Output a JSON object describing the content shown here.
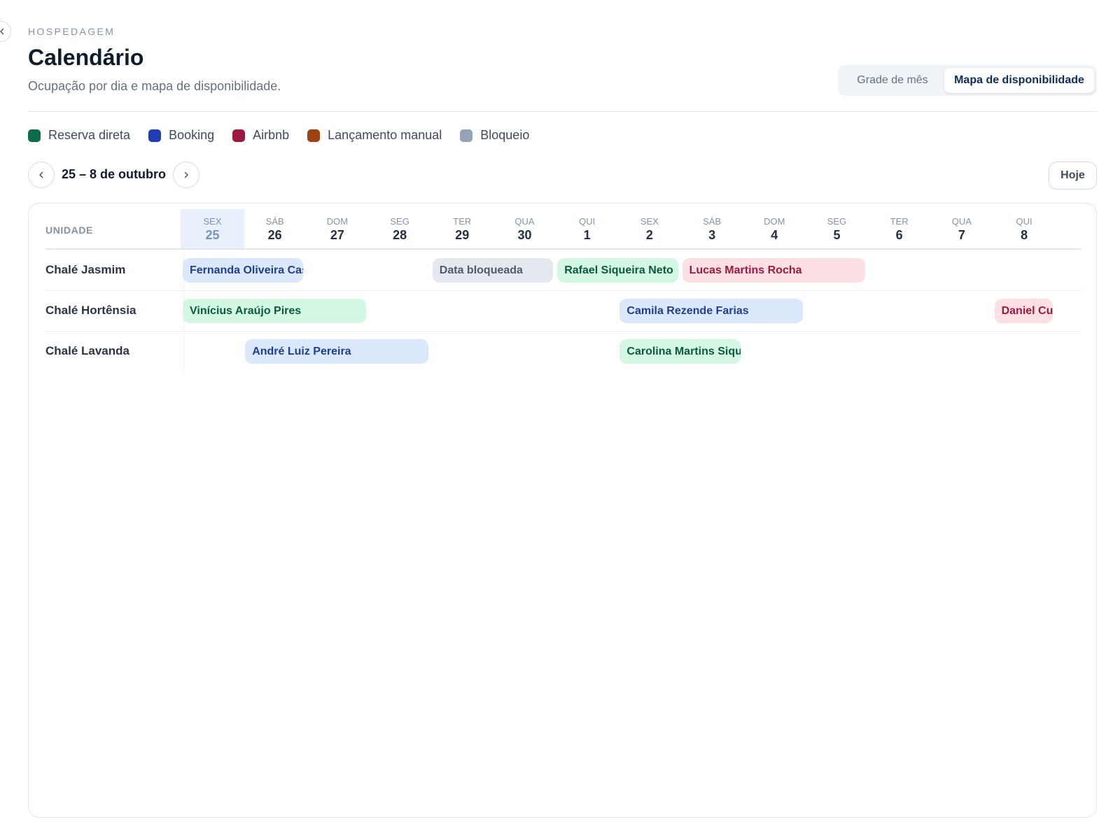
{
  "header": {
    "eyebrow": "HOSPEDAGEM",
    "title": "Calendário",
    "subtitle": "Ocupação por dia e mapa de disponibilidade."
  },
  "view_toggle": {
    "month_grid": "Grade de mês",
    "availability_map": "Mapa de disponibilidade",
    "selected": "availability_map"
  },
  "legend": [
    {
      "label": "Reserva direta",
      "color": "#0b6b4a"
    },
    {
      "label": "Booking",
      "color": "#1f3fb0"
    },
    {
      "label": "Airbnb",
      "color": "#a0183f"
    },
    {
      "label": "Lançamento manual",
      "color": "#9a4210"
    },
    {
      "label": "Bloqueio",
      "color": "#94a3b8"
    }
  ],
  "navigation": {
    "range_label": "25 – 8 de outubro",
    "today_label": "Hoje"
  },
  "grid": {
    "unit_header": "UNIDADE",
    "today_index": 0,
    "days": [
      {
        "dow": "SEX",
        "num": "25"
      },
      {
        "dow": "SÁB",
        "num": "26"
      },
      {
        "dow": "DOM",
        "num": "27"
      },
      {
        "dow": "SEG",
        "num": "28"
      },
      {
        "dow": "TER",
        "num": "29"
      },
      {
        "dow": "QUA",
        "num": "30"
      },
      {
        "dow": "QUI",
        "num": "1"
      },
      {
        "dow": "SEX",
        "num": "2"
      },
      {
        "dow": "SÁB",
        "num": "3"
      },
      {
        "dow": "DOM",
        "num": "4"
      },
      {
        "dow": "SEG",
        "num": "5"
      },
      {
        "dow": "TER",
        "num": "6"
      },
      {
        "dow": "QUA",
        "num": "7"
      },
      {
        "dow": "QUI",
        "num": "8"
      }
    ],
    "units": [
      {
        "name": "Chalé Jasmim",
        "bookings": [
          {
            "label": "Fernanda Oliveira Cast",
            "source": "booking",
            "start": 0,
            "end": 2
          },
          {
            "label": "Data bloqueada",
            "source": "block",
            "start": 4,
            "end": 6
          },
          {
            "label": "Rafael Siqueira Neto",
            "source": "direct",
            "start": 6,
            "end": 8
          },
          {
            "label": "Lucas Martins Rocha",
            "source": "airbnb",
            "start": 8,
            "end": 11
          }
        ]
      },
      {
        "name": "Chalé Hortênsia",
        "bookings": [
          {
            "label": "Vinícius Araújo Pires",
            "source": "direct",
            "start": 0,
            "end": 3
          },
          {
            "label": "Camila Rezende Farias",
            "source": "booking",
            "start": 7,
            "end": 10
          },
          {
            "label": "Daniel Cur",
            "source": "airbnb",
            "start": 13,
            "end": 14
          }
        ]
      },
      {
        "name": "Chalé Lavanda",
        "bookings": [
          {
            "label": "André Luiz Pereira",
            "source": "booking",
            "start": 1,
            "end": 4
          },
          {
            "label": "Carolina Martins Sique",
            "source": "direct",
            "start": 7,
            "end": 9
          }
        ]
      }
    ]
  },
  "bar_styles": {
    "booking": {
      "bg": "#dbe8fb",
      "fg": "#1f3f95"
    },
    "block": {
      "bg": "#e5e9ef",
      "fg": "#4f5b6b"
    },
    "direct": {
      "bg": "#d3f7e3",
      "fg": "#0b5a3d"
    },
    "airbnb": {
      "bg": "#fde0e3",
      "fg": "#a0183f"
    }
  }
}
